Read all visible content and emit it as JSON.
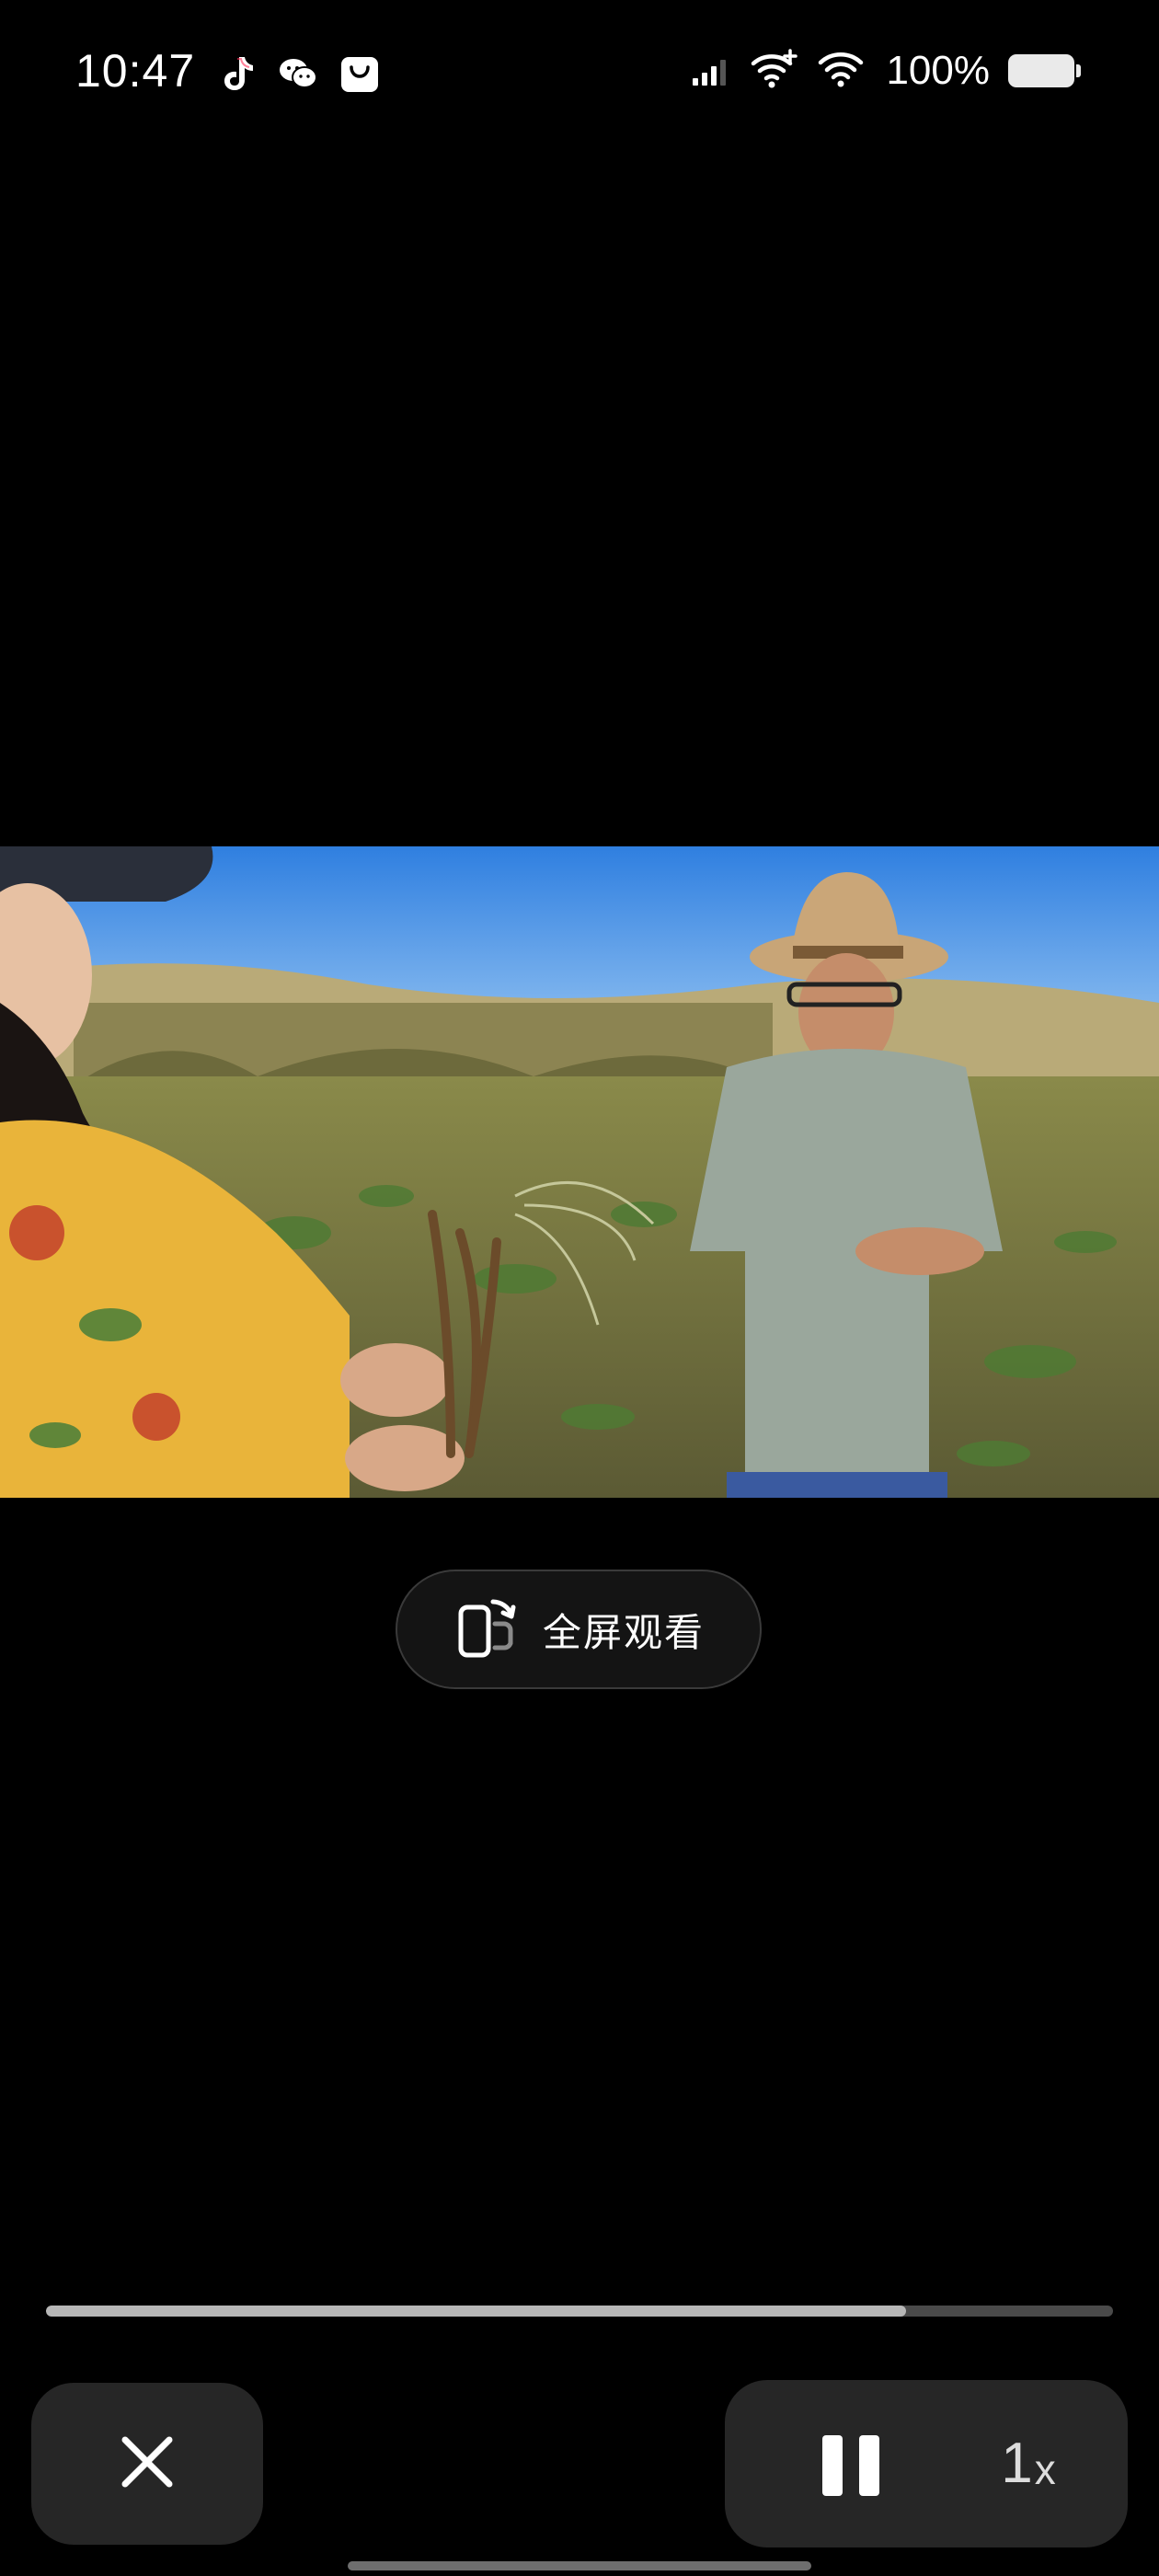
{
  "status_bar": {
    "time": "10:47",
    "battery_text": "100%",
    "app_icons": [
      "tiktok-icon",
      "wechat-icon",
      "shopping-bag-icon"
    ],
    "system_icons": [
      "cellular-signal-icon",
      "wifi-plus-icon",
      "wifi-icon",
      "battery-icon"
    ]
  },
  "video": {
    "description_icon": "video-frame",
    "fullscreen_label": "全屏观看"
  },
  "player": {
    "progress_fraction": 0.806,
    "speed_number": "1",
    "speed_suffix": "x"
  },
  "colors": {
    "background": "#000000",
    "control_bg": "#262626",
    "progress_track": "#4a4a4a",
    "progress_fill": "#b7b7b7"
  }
}
